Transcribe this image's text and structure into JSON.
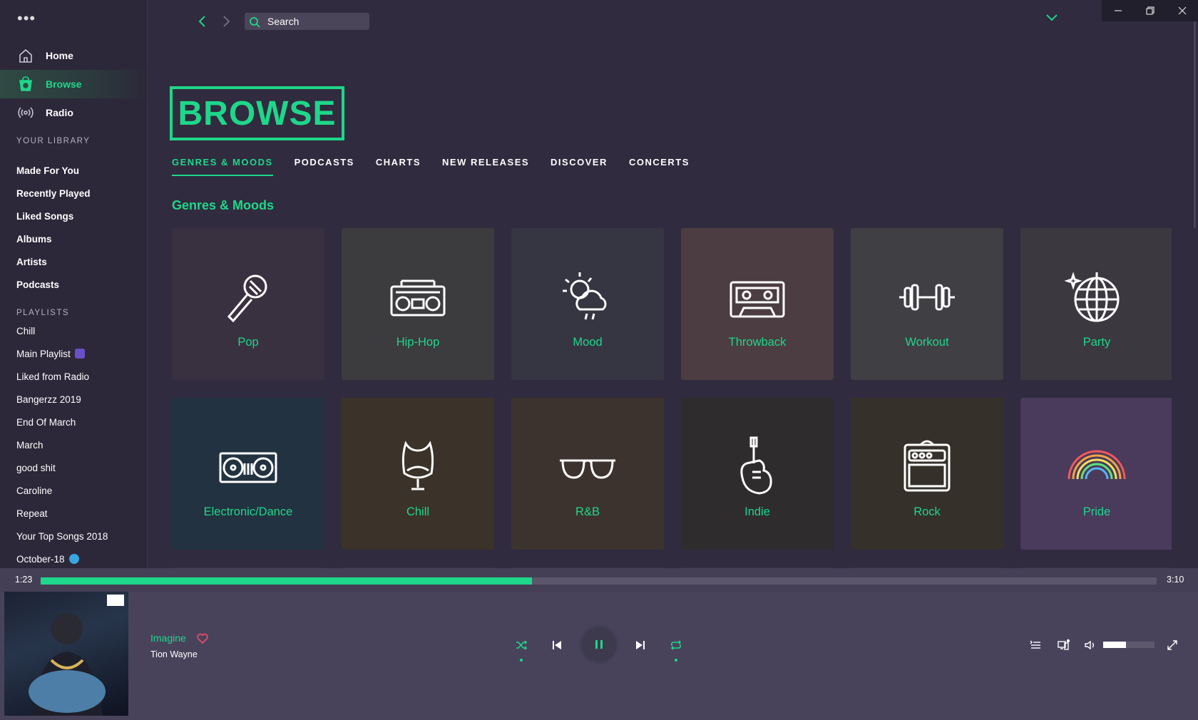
{
  "window": {
    "controls": [
      "minimize",
      "restore",
      "close"
    ]
  },
  "sidebar": {
    "nav": [
      {
        "label": "Home",
        "icon": "home-icon"
      },
      {
        "label": "Browse",
        "icon": "browse-icon",
        "active": true
      },
      {
        "label": "Radio",
        "icon": "radio-icon"
      }
    ],
    "library_title": "YOUR LIBRARY",
    "library": [
      "Made For You",
      "Recently Played",
      "Liked Songs",
      "Albums",
      "Artists",
      "Podcasts"
    ],
    "playlists_title": "PLAYLISTS",
    "playlists": [
      "Chill",
      "Main Playlist",
      "Liked from Radio",
      "Bangerzz 2019",
      "End Of March",
      "March",
      "good shit",
      "Caroline",
      "Repeat",
      "Your Top Songs 2018",
      "October-18"
    ]
  },
  "topbar": {
    "search_placeholder": "Search"
  },
  "main": {
    "title": "BROWSE",
    "tabs": [
      {
        "label": "GENRES & MOODS",
        "active": true
      },
      {
        "label": "PODCASTS"
      },
      {
        "label": "CHARTS"
      },
      {
        "label": "NEW RELEASES"
      },
      {
        "label": "DISCOVER"
      },
      {
        "label": "CONCERTS"
      }
    ],
    "section": "Genres & Moods",
    "tiles": [
      {
        "label": "Pop",
        "icon": "microphone-icon",
        "bg": "#3a3140"
      },
      {
        "label": "Hip-Hop",
        "icon": "boombox-icon",
        "bg": "#3c3b3e"
      },
      {
        "label": "Mood",
        "icon": "weather-icon",
        "bg": "#363542"
      },
      {
        "label": "Throwback",
        "icon": "cassette-icon",
        "bg": "#4b3d42"
      },
      {
        "label": "Workout",
        "icon": "dumbbell-icon",
        "bg": "#3f3f44"
      },
      {
        "label": "Party",
        "icon": "disco-ball-icon",
        "bg": "#3b3840"
      },
      {
        "label": "Electronic/Dance",
        "icon": "turntable-icon",
        "bg": "#223240"
      },
      {
        "label": "Chill",
        "icon": "egg-chair-icon",
        "bg": "#3b3329"
      },
      {
        "label": "R&B",
        "icon": "sunglasses-icon",
        "bg": "#3d332e"
      },
      {
        "label": "Indie",
        "icon": "guitar-icon",
        "bg": "#2f2c2e"
      },
      {
        "label": "Rock",
        "icon": "amplifier-icon",
        "bg": "#35302a"
      },
      {
        "label": "Pride",
        "icon": "rainbow-icon",
        "bg": "#4a3a5c"
      }
    ]
  },
  "player": {
    "elapsed": "1:23",
    "duration": "3:10",
    "progress": 0.44,
    "track": "Imagine",
    "artist": "Tion Wayne",
    "volume": 0.45,
    "colors": {
      "accent": "#1ed78a",
      "heart": "#e54b6b"
    }
  }
}
